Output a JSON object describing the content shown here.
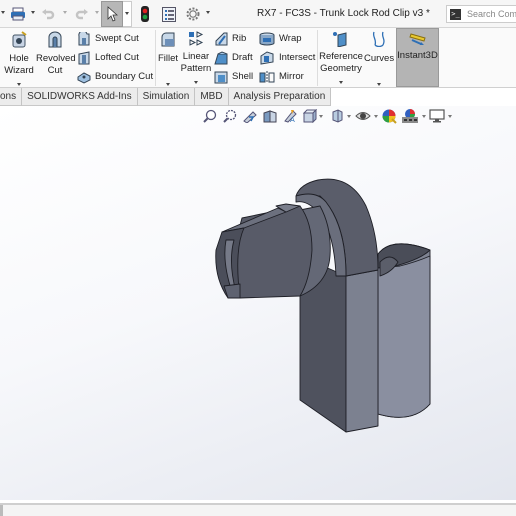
{
  "titlebar": {
    "title": "RX7 - FC3S - Trunk Lock Rod Clip v3 *",
    "search_placeholder": "Search Comm",
    "quick_access": [
      {
        "icon": "print-icon"
      },
      {
        "icon": "undo-icon",
        "enabled": false
      },
      {
        "icon": "redo-icon",
        "enabled": false
      },
      {
        "icon": "select-cursor-icon",
        "active": true
      },
      {
        "icon": "rebuild-traffic-light-icon"
      },
      {
        "icon": "file-properties-icon"
      },
      {
        "icon": "options-gear-icon"
      }
    ]
  },
  "ribbon": {
    "large_buttons": [
      {
        "id": "hole-wizard",
        "lines": [
          "Hole",
          "Wizard"
        ],
        "has_dropdown": true
      },
      {
        "id": "revolved-cut",
        "lines": [
          "Revolved",
          "Cut"
        ],
        "has_dropdown": false
      },
      {
        "id": "fillet",
        "lines": [
          "Fillet"
        ],
        "has_dropdown": true
      },
      {
        "id": "linear-pattern",
        "lines": [
          "Linear",
          "Pattern"
        ],
        "has_dropdown": true
      },
      {
        "id": "reference-geometry",
        "lines": [
          "Reference",
          "Geometry"
        ],
        "has_dropdown": true
      },
      {
        "id": "curves",
        "lines": [
          "Curves"
        ],
        "has_dropdown": true
      },
      {
        "id": "instant3d",
        "lines": [
          "Instant3D"
        ],
        "has_dropdown": false,
        "active": true
      }
    ],
    "small_buttons": [
      {
        "id": "swept-cut",
        "label": "Swept Cut"
      },
      {
        "id": "lofted-cut",
        "label": "Lofted Cut"
      },
      {
        "id": "boundary-cut",
        "label": "Boundary Cut"
      },
      {
        "id": "rib",
        "label": "Rib"
      },
      {
        "id": "draft",
        "label": "Draft"
      },
      {
        "id": "shell",
        "label": "Shell"
      },
      {
        "id": "wrap",
        "label": "Wrap"
      },
      {
        "id": "intersect",
        "label": "Intersect"
      },
      {
        "id": "mirror",
        "label": "Mirror"
      }
    ]
  },
  "tabs": [
    {
      "label": "ons"
    },
    {
      "label": "SOLIDWORKS Add-Ins"
    },
    {
      "label": "Simulation"
    },
    {
      "label": "MBD"
    },
    {
      "label": "Analysis Preparation"
    }
  ],
  "heads_up_toolbar": [
    {
      "icon": "zoom-to-fit-icon"
    },
    {
      "icon": "zoom-to-area-icon"
    },
    {
      "icon": "previous-view-icon"
    },
    {
      "icon": "section-view-icon"
    },
    {
      "icon": "dynamic-annotation-views-icon"
    },
    {
      "icon": "view-orientation-icon",
      "has_dropdown": true
    },
    {
      "icon": "display-style-icon",
      "has_dropdown": true
    },
    {
      "icon": "hide-show-items-icon",
      "has_dropdown": true
    },
    {
      "icon": "edit-appearance-icon"
    },
    {
      "icon": "apply-scene-icon",
      "has_dropdown": true
    },
    {
      "icon": "view-settings-icon",
      "has_dropdown": true
    }
  ],
  "model": {
    "name": "Trunk Lock Rod Clip",
    "body_color": "#5c5f6c"
  }
}
